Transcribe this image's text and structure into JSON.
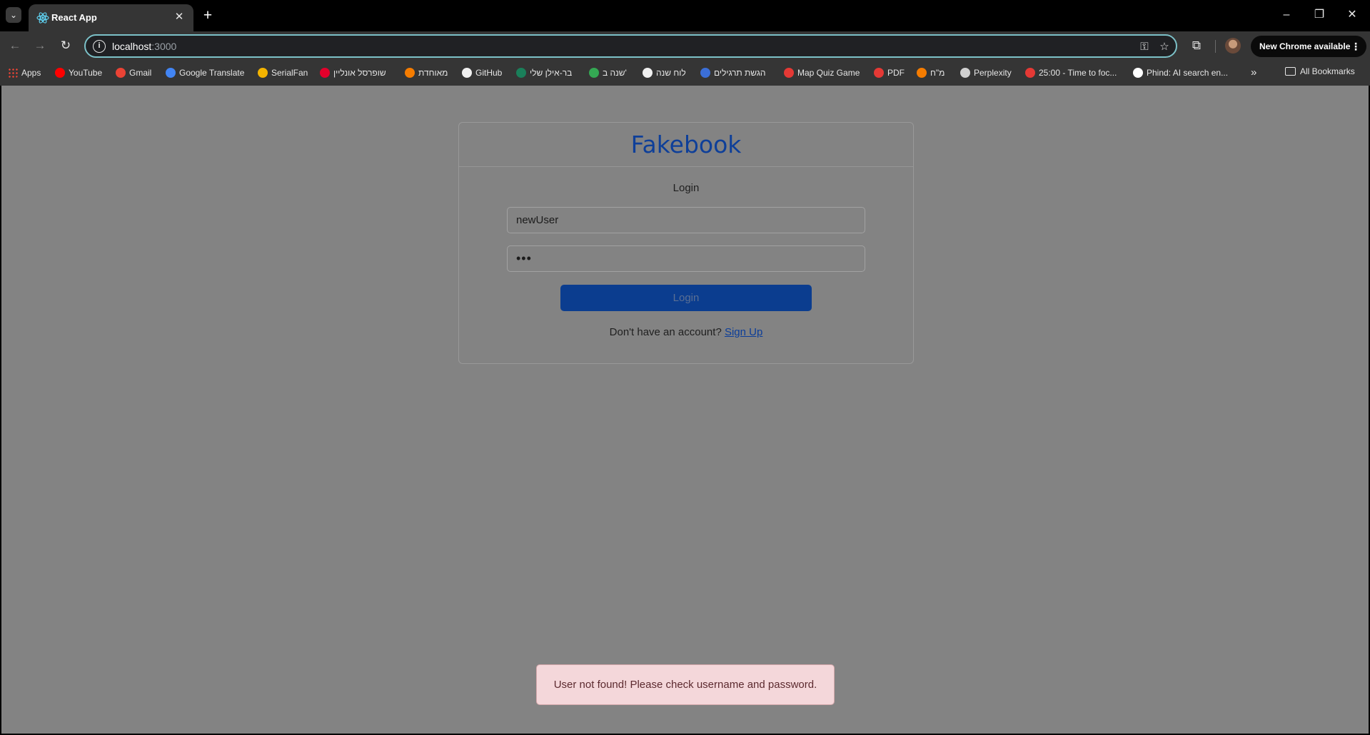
{
  "tab": {
    "title": "React App",
    "close": "✕",
    "new_tab": "+"
  },
  "window_controls": {
    "minimize": "–",
    "restore": "❐",
    "close": "✕"
  },
  "address_bar": {
    "host": "localhost",
    "port": ":3000"
  },
  "update_button": {
    "label": "New Chrome available",
    "menu": "⋮"
  },
  "bookmarks": [
    {
      "label": "Apps",
      "icon": "apps-grid-icon",
      "color": "#ea4335"
    },
    {
      "label": "YouTube",
      "icon": "youtube-icon",
      "color": "#ff0000"
    },
    {
      "label": "Gmail",
      "icon": "gmail-icon",
      "color": "#ea4335"
    },
    {
      "label": "Google Translate",
      "icon": "translate-icon",
      "color": "#4285f4"
    },
    {
      "label": "SerialFan",
      "icon": "serialfan-icon",
      "color": "#f4b400"
    },
    {
      "label": "שופרסל אונליין",
      "icon": "shufersal-icon",
      "color": "#e4002b"
    },
    {
      "label": "מאוחדת",
      "icon": "meuhedet-icon",
      "color": "#f57c00"
    },
    {
      "label": "GitHub",
      "icon": "github-icon",
      "color": "#f0f0f0"
    },
    {
      "label": "בר-אילן שלי",
      "icon": "bar-ilan-icon",
      "color": "#1a7f5a"
    },
    {
      "label": "שנה ב'",
      "icon": "google-drive-icon",
      "color": "#34a853"
    },
    {
      "label": "לוח שנה",
      "icon": "calendar-icon",
      "color": "#f0f0f0"
    },
    {
      "label": "הגשת תרגילים",
      "icon": "submit-upload-icon",
      "color": "#3b6fd8"
    },
    {
      "label": "Map Quiz Game",
      "icon": "map-pin-icon",
      "color": "#e53935"
    },
    {
      "label": "PDF",
      "icon": "pdf-heart-icon",
      "color": "#e53935"
    },
    {
      "label": "מ\"ח",
      "icon": "mh-icon",
      "color": "#f57c00"
    },
    {
      "label": "Perplexity",
      "icon": "perplexity-icon",
      "color": "#d0d0d0"
    },
    {
      "label": "25:00 - Time to foc...",
      "icon": "timer-check-icon",
      "color": "#e53935"
    },
    {
      "label": "Phind: AI search en...",
      "icon": "phind-icon",
      "color": "#ffffff"
    }
  ],
  "bookmarks_more": "»",
  "all_bookmarks": "All Bookmarks",
  "app": {
    "brand": "Fakebook",
    "form_title": "Login",
    "username_value": "newUser",
    "password_value": "•••",
    "login_button": "Login",
    "signup_prompt": "Don't have an account?",
    "signup_link": "Sign Up",
    "error_message": "User not found! Please check username and password."
  }
}
